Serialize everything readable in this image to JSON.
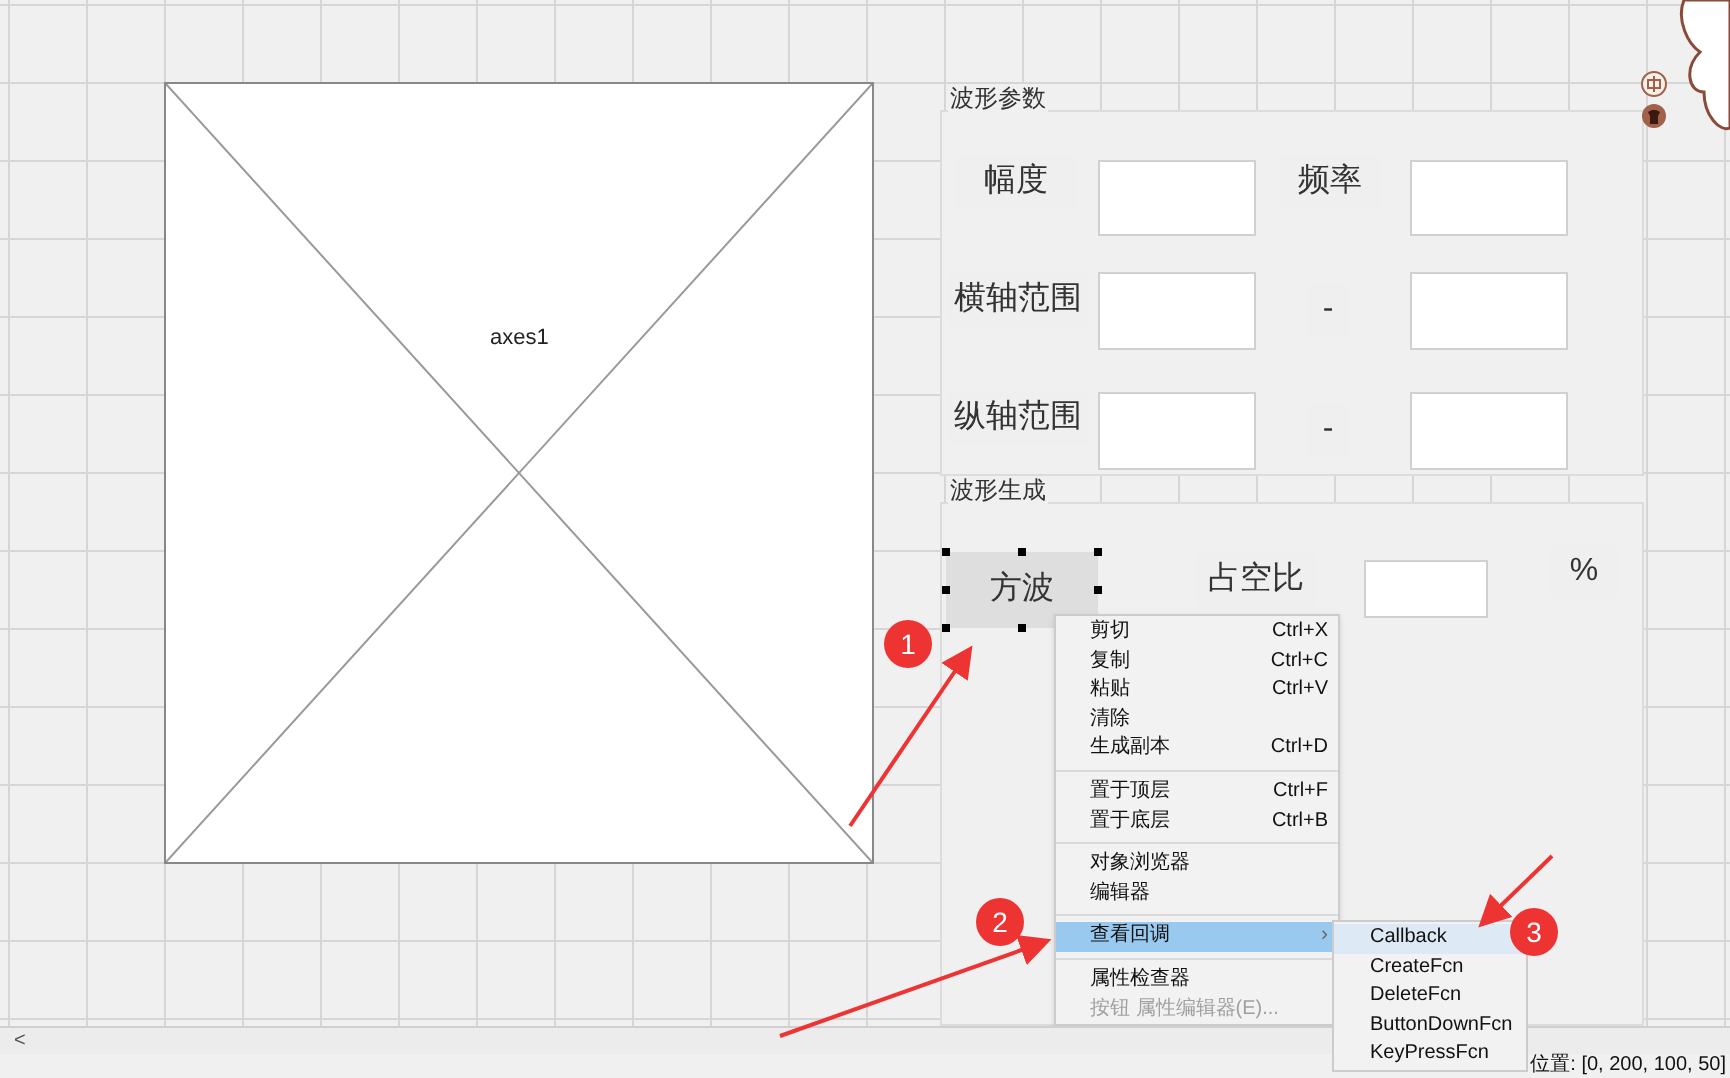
{
  "axes": {
    "label": "axes1"
  },
  "panels": [
    {
      "title": "波形参数"
    },
    {
      "title": "波形生成"
    }
  ],
  "controls": [
    {
      "kind": "text",
      "text": "幅度"
    },
    {
      "kind": "edit"
    },
    {
      "kind": "text",
      "text": "频率"
    },
    {
      "kind": "edit"
    },
    {
      "kind": "text",
      "text": "横轴范围"
    },
    {
      "kind": "edit"
    },
    {
      "kind": "text",
      "text": "-"
    },
    {
      "kind": "edit"
    },
    {
      "kind": "text",
      "text": "纵轴范围"
    },
    {
      "kind": "edit"
    },
    {
      "kind": "text",
      "text": "-"
    },
    {
      "kind": "edit"
    },
    {
      "kind": "button",
      "text": "方波",
      "selected": true
    },
    {
      "kind": "text",
      "text": "占空比"
    },
    {
      "kind": "edit"
    },
    {
      "kind": "text",
      "text": "%"
    }
  ],
  "context_menu": [
    [
      {
        "label": "剪切",
        "shortcut": "Ctrl+X",
        "selected": false,
        "disabled": false
      },
      {
        "label": "复制",
        "shortcut": "Ctrl+C",
        "selected": false,
        "disabled": false
      },
      {
        "label": "粘贴",
        "shortcut": "Ctrl+V",
        "selected": false,
        "disabled": false
      },
      {
        "label": "清除",
        "selected": false,
        "disabled": false
      },
      {
        "label": "生成副本",
        "shortcut": "Ctrl+D",
        "selected": false,
        "disabled": false
      }
    ],
    [
      {
        "label": "置于顶层",
        "shortcut": "Ctrl+F",
        "selected": false,
        "disabled": false
      },
      {
        "label": "置于底层",
        "shortcut": "Ctrl+B",
        "selected": false,
        "disabled": false
      }
    ],
    [
      {
        "label": "对象浏览器",
        "selected": false,
        "disabled": false
      },
      {
        "label": "编辑器",
        "selected": false,
        "disabled": false
      }
    ],
    [
      {
        "label": "查看回调",
        "submenu": "›",
        "selected": true,
        "disabled": false
      }
    ],
    [
      {
        "label": "属性检查器",
        "selected": false,
        "disabled": false
      },
      {
        "label": "按钮 属性编辑器(E)...",
        "selected": false,
        "disabled": true
      }
    ]
  ],
  "submenu": [
    {
      "label": "Callback",
      "selected": true
    },
    {
      "label": "CreateFcn",
      "selected": false
    },
    {
      "label": "DeleteFcn",
      "selected": false
    },
    {
      "label": "ButtonDownFcn",
      "selected": false
    },
    {
      "label": "KeyPressFcn",
      "selected": false
    }
  ],
  "scrollbar": {
    "arrow": "<"
  },
  "status_bar": {
    "position": "位置: [0, 200, 100, 50]"
  },
  "markers": [
    {
      "number": "1"
    },
    {
      "number": "2"
    },
    {
      "number": "3"
    }
  ]
}
